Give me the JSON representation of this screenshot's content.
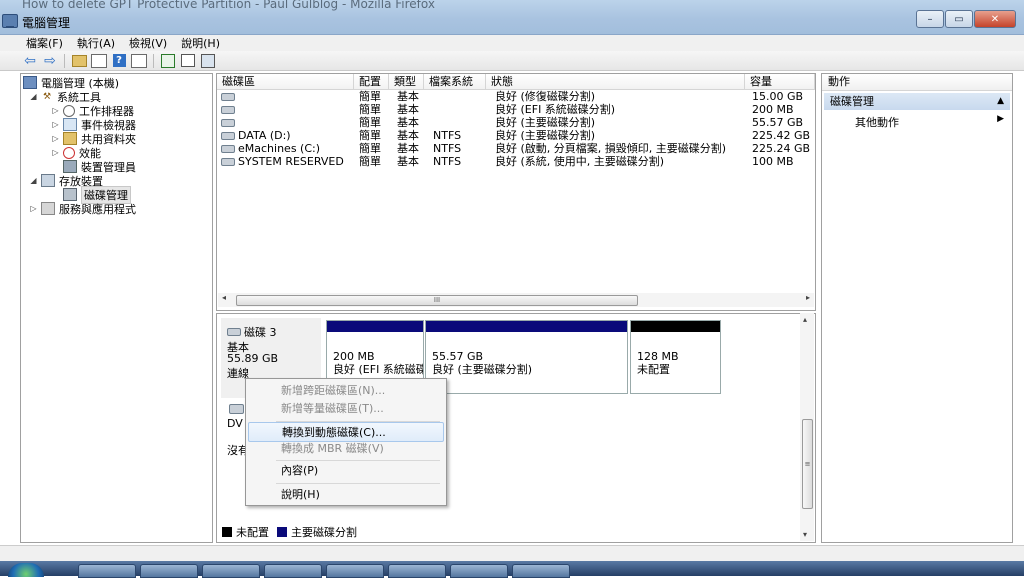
{
  "browser": {
    "ghost_title": "How to delete GPT Protective Partition - Paul Gulblog - Mozilla Firefox"
  },
  "window": {
    "title": "電腦管理",
    "controls": {
      "minimize": "–",
      "maximize": "▭",
      "close": "✕"
    }
  },
  "menu": [
    "檔案(F)",
    "執行(A)",
    "檢視(V)",
    "說明(H)"
  ],
  "toolbar": {
    "icons": [
      "back-arrow-icon",
      "forward-arrow-icon",
      "up-folder-icon",
      "show-hide-tree-icon",
      "help-icon",
      "show-hide-action-icon",
      "refresh-icon",
      "export-icon",
      "properties-icon"
    ],
    "back": "⇦",
    "forward": "⇨",
    "help": "?"
  },
  "tree": {
    "root": "電腦管理 (本機)",
    "system_tools": "系統工具",
    "task_scheduler": "工作排程器",
    "event_viewer": "事件檢視器",
    "shared_folders": "共用資料夾",
    "performance": "效能",
    "device_manager": "裝置管理員",
    "storage": "存放裝置",
    "disk_management": "磁碟管理",
    "services_apps": "服務與應用程式"
  },
  "volumes": {
    "columns": [
      "磁碟區",
      "配置",
      "類型",
      "檔案系統",
      "狀態",
      "容量"
    ],
    "rows": [
      {
        "name": "",
        "layout": "簡單",
        "type": "基本",
        "fs": "",
        "status": "良好 (修復磁碟分割)",
        "capacity": "15.00 GB"
      },
      {
        "name": "",
        "layout": "簡單",
        "type": "基本",
        "fs": "",
        "status": "良好 (EFI 系統磁碟分割)",
        "capacity": "200 MB"
      },
      {
        "name": "",
        "layout": "簡單",
        "type": "基本",
        "fs": "",
        "status": "良好 (主要磁碟分割)",
        "capacity": "55.57 GB"
      },
      {
        "name": "DATA (D:)",
        "layout": "簡單",
        "type": "基本",
        "fs": "NTFS",
        "status": "良好 (主要磁碟分割)",
        "capacity": "225.42 GB"
      },
      {
        "name": "eMachines (C:)",
        "layout": "簡單",
        "type": "基本",
        "fs": "NTFS",
        "status": "良好 (啟動, 分頁檔案, 損毀傾印, 主要磁碟分割)",
        "capacity": "225.24 GB"
      },
      {
        "name": "SYSTEM RESERVED",
        "layout": "簡單",
        "type": "基本",
        "fs": "NTFS",
        "status": "良好 (系統, 使用中, 主要磁碟分割)",
        "capacity": "100 MB"
      }
    ],
    "scroll_grip": "III"
  },
  "disk": {
    "name": "磁碟 3",
    "type": "基本",
    "size": "55.89 GB",
    "status": "連線",
    "partitions": [
      {
        "size": "200 MB",
        "status": "良好 (EFI 系統磁碟分割)",
        "kind": "primary"
      },
      {
        "size": "55.57 GB",
        "status": "良好 (主要磁碟分割)",
        "kind": "primary"
      },
      {
        "size": "128 MB",
        "status": "未配置",
        "kind": "unalloc"
      }
    ],
    "dvd_label": "DV",
    "dvd_status": "沒有",
    "vscroll_grip": "≡"
  },
  "context_menu": {
    "items": [
      {
        "label": "新增跨距磁碟區(N)...",
        "enabled": false
      },
      {
        "label": "新增等量磁碟區(T)...",
        "enabled": false
      },
      {
        "label": "轉換到動態磁碟(C)...",
        "enabled": true,
        "highlighted": true
      },
      {
        "label": "轉換成 MBR 磁碟(V)",
        "enabled": false
      },
      {
        "label": "內容(P)",
        "enabled": true
      },
      {
        "label": "說明(H)",
        "enabled": true
      }
    ]
  },
  "legend": [
    {
      "label": "未配置",
      "color": "#000000"
    },
    {
      "label": "主要磁碟分割",
      "color": "#0a0a7a"
    }
  ],
  "actions": {
    "header": "動作",
    "section": "磁碟管理",
    "more": "其他動作",
    "collapse": "▲",
    "arrow": "▶"
  }
}
